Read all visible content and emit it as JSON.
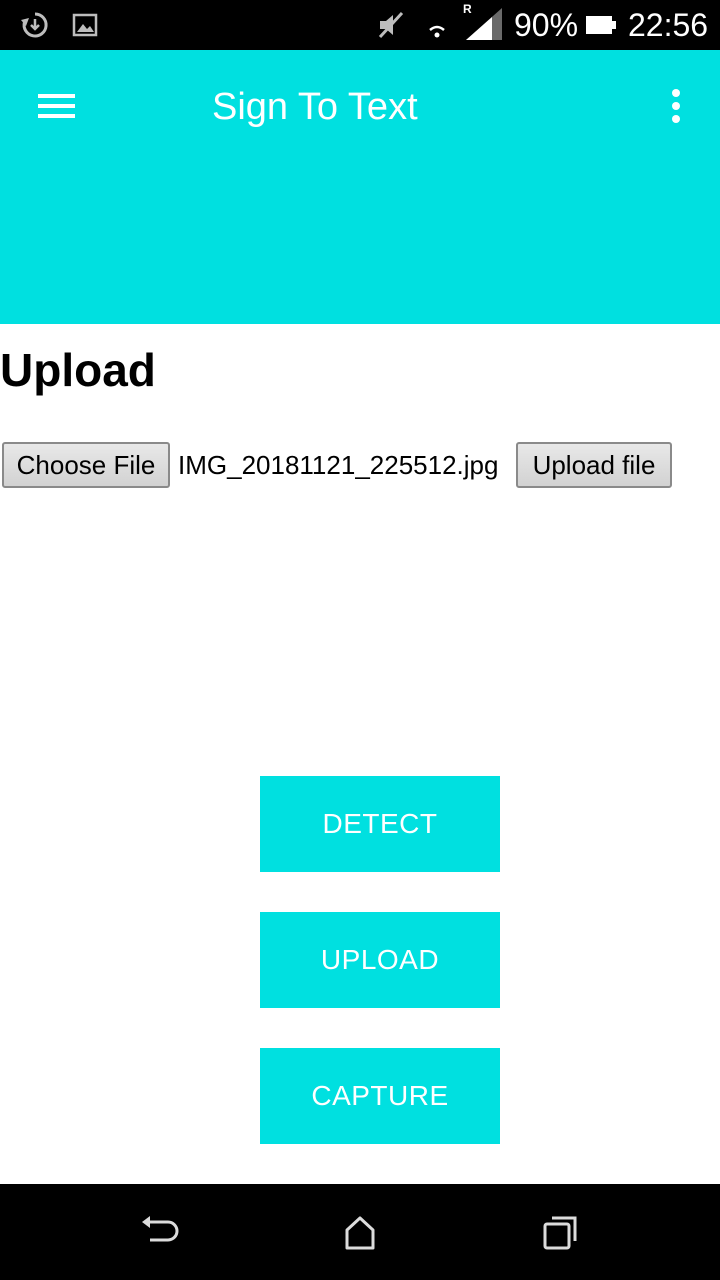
{
  "status_bar": {
    "battery_percent": "90%",
    "time": "22:56",
    "roaming_indicator": "R",
    "icons": [
      "sync-icon",
      "image-notification-icon",
      "mute-icon",
      "wifi-icon",
      "signal-icon",
      "battery-icon"
    ]
  },
  "app_bar": {
    "title": "Sign To Text",
    "menu_icon": "hamburger-menu-icon",
    "overflow_icon": "more-vertical-icon",
    "background_color": "#00e0e0"
  },
  "content": {
    "heading": "Upload",
    "choose_file_label": "Choose File",
    "selected_file_name": "IMG_20181121_225512.jpg",
    "upload_file_label": "Upload file"
  },
  "actions": {
    "detect_label": "DETECT",
    "upload_label": "UPLOAD",
    "capture_label": "CAPTURE",
    "button_color": "#00e0e0"
  },
  "nav_bar": {
    "icons": [
      "back-icon",
      "home-icon",
      "recents-icon"
    ]
  }
}
